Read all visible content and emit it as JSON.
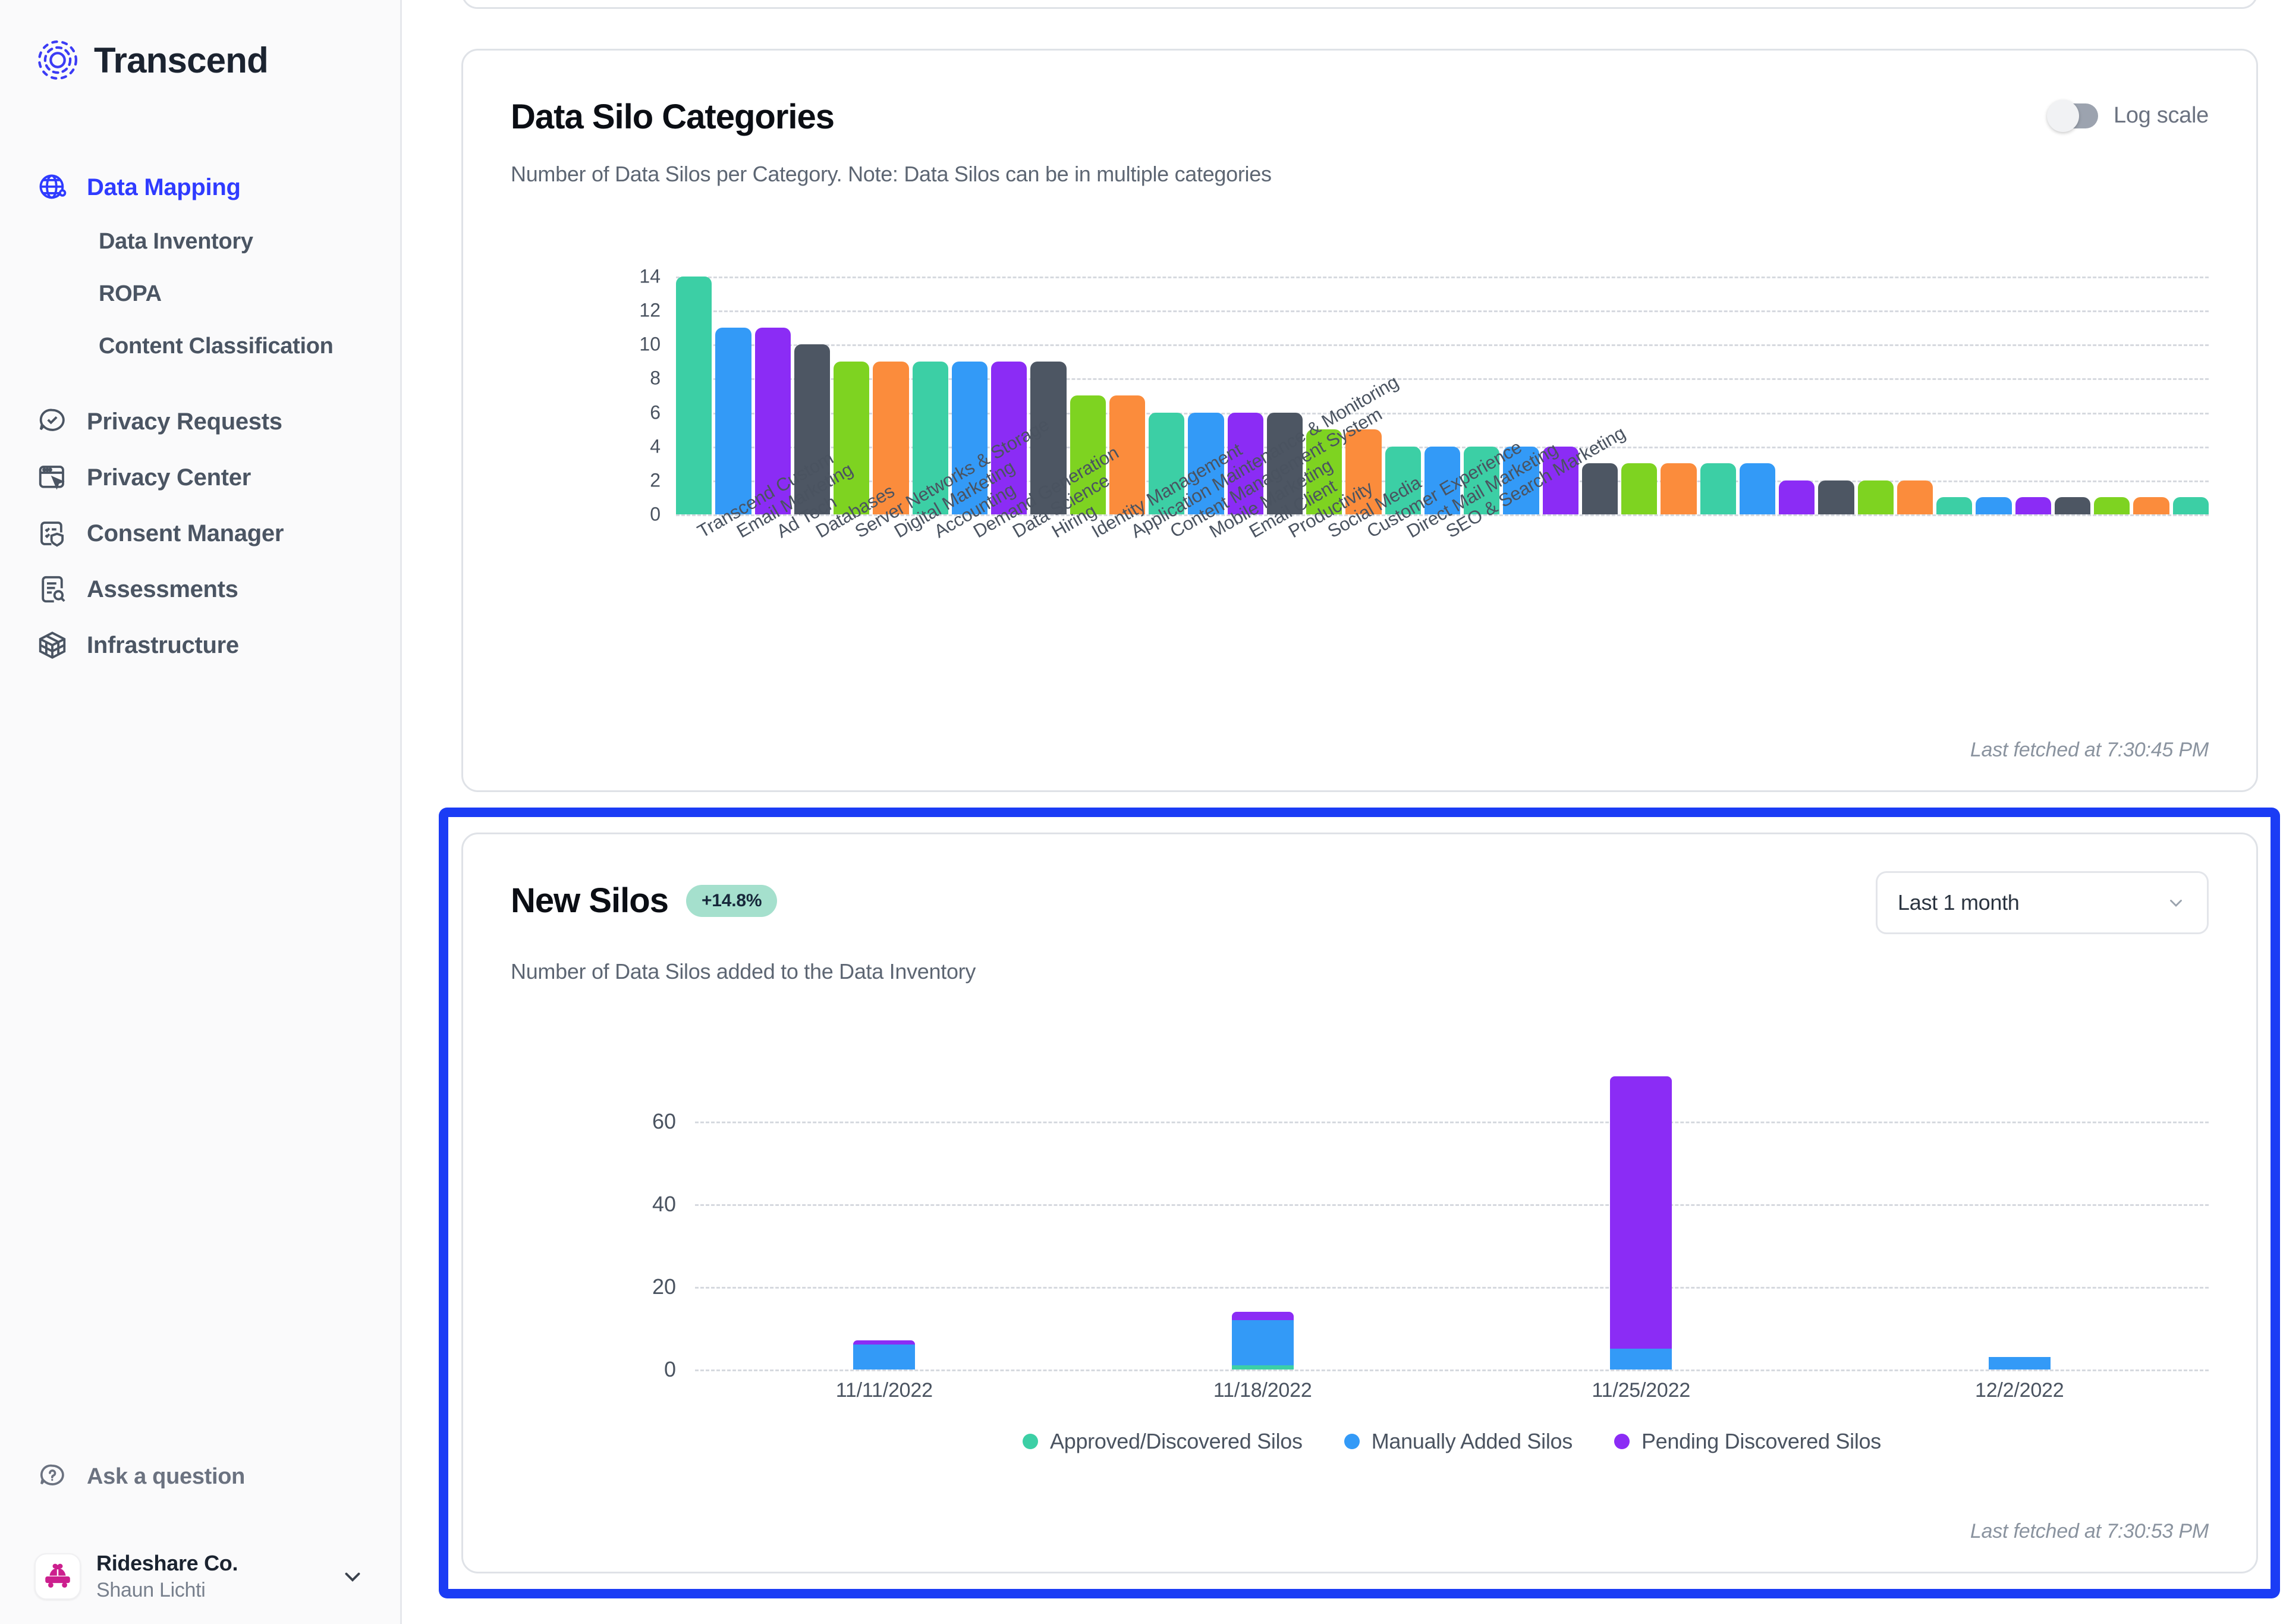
{
  "brand": {
    "name": "Transcend",
    "logo_icon": "transcend-logo-icon"
  },
  "sidebar": {
    "items": [
      {
        "label": "Data Mapping",
        "icon": "globe-icon",
        "active": true
      },
      {
        "label": "Privacy Requests",
        "icon": "chat-check-icon",
        "active": false
      },
      {
        "label": "Privacy Center",
        "icon": "browser-cursor-icon",
        "active": false
      },
      {
        "label": "Consent Manager",
        "icon": "shield-checklist-icon",
        "active": false
      },
      {
        "label": "Assessments",
        "icon": "document-search-icon",
        "active": false
      },
      {
        "label": "Infrastructure",
        "icon": "cube-icon",
        "active": false
      }
    ],
    "sub_items": [
      {
        "label": "Data Inventory"
      },
      {
        "label": "ROPA"
      },
      {
        "label": "Content Classification"
      }
    ],
    "help": {
      "label": "Ask a question",
      "icon": "question-bubble-icon"
    },
    "profile": {
      "org": "Rideshare Co.",
      "user": "Shaun Lichti",
      "avatar_icon": "rideshare-car-icon",
      "chevron_icon": "chevron-down-icon"
    }
  },
  "colors": {
    "accent": "#2f3bff",
    "focus_ring": "#1b3cf5",
    "badge_bg": "#a5e0cd",
    "green": "#3ccfa5",
    "blue": "#339af7",
    "purple": "#8b2cf5",
    "slate": "#4d5663",
    "lime": "#7ed321",
    "orange": "#fb8c3c"
  },
  "silo_card": {
    "title": "Data Silo Categories",
    "subtitle": "Number of Data Silos per Category. Note: Data Silos can be in multiple categories",
    "toggle_label": "Log scale",
    "toggle_on": false,
    "fetched": "Last fetched at 7:30:45 PM"
  },
  "new_silos_card": {
    "title": "New Silos",
    "badge": "+14.8%",
    "subtitle": "Number of Data Silos added to the Data Inventory",
    "range_value": "Last 1 month",
    "range_options": [
      "Last 1 month"
    ],
    "fetched": "Last fetched at 7:30:53 PM"
  },
  "chart_data": [
    {
      "type": "bar",
      "title": "Data Silo Categories",
      "xlabel": "",
      "ylabel": "",
      "ylim": [
        0,
        14
      ],
      "yticks": [
        0,
        2,
        4,
        6,
        8,
        10,
        12,
        14
      ],
      "grid": true,
      "legend": "none",
      "categories": [
        "Transcend Custom",
        "Email Marketing",
        "Ad Tech",
        "Databases",
        "Server Networks & Storage",
        "Digital Marketing",
        "Accounting",
        "Demand Generation",
        "Data Science",
        "Hiring",
        "Identity Management",
        "Application Maintenance & Monitoring",
        "Content Management System",
        "Mobile Marketing",
        "Email Client",
        "Productivity",
        "Social Media",
        "Customer Experience",
        "Direct Mail Marketing",
        "SEO & Search Marketing"
      ],
      "values": [
        14,
        11,
        11,
        10,
        9,
        9,
        9,
        9,
        9,
        9,
        7,
        7,
        6,
        6,
        6,
        6,
        5,
        5,
        4,
        4
      ],
      "extra_values": [
        4,
        4,
        4,
        3,
        3,
        3,
        3,
        3,
        2,
        2,
        2,
        2,
        1,
        1,
        1,
        1,
        1,
        1,
        1
      ],
      "bar_colors": [
        "#3ccfa5",
        "#339af7",
        "#8b2cf5",
        "#4d5663",
        "#7ed321",
        "#fb8c3c",
        "#3ccfa5",
        "#339af7",
        "#8b2cf5",
        "#4d5663",
        "#7ed321",
        "#fb8c3c",
        "#3ccfa5",
        "#339af7",
        "#8b2cf5",
        "#4d5663",
        "#7ed321",
        "#fb8c3c",
        "#3ccfa5",
        "#339af7"
      ]
    },
    {
      "type": "bar",
      "stacked": true,
      "title": "New Silos",
      "xlabel": "",
      "ylabel": "",
      "ylim": [
        0,
        72
      ],
      "yticks": [
        0,
        20,
        40,
        60
      ],
      "grid": true,
      "legend": "bottom",
      "categories": [
        "11/11/2022",
        "11/18/2022",
        "11/25/2022",
        "12/2/2022"
      ],
      "series": [
        {
          "name": "Approved/Discovered Silos",
          "color": "#3ccfa5",
          "values": [
            0,
            1,
            0,
            0
          ]
        },
        {
          "name": "Manually Added Silos",
          "color": "#339af7",
          "values": [
            6,
            11,
            5,
            3
          ]
        },
        {
          "name": "Pending Discovered Silos",
          "color": "#8b2cf5",
          "values": [
            1,
            2,
            66,
            0
          ]
        }
      ]
    }
  ]
}
